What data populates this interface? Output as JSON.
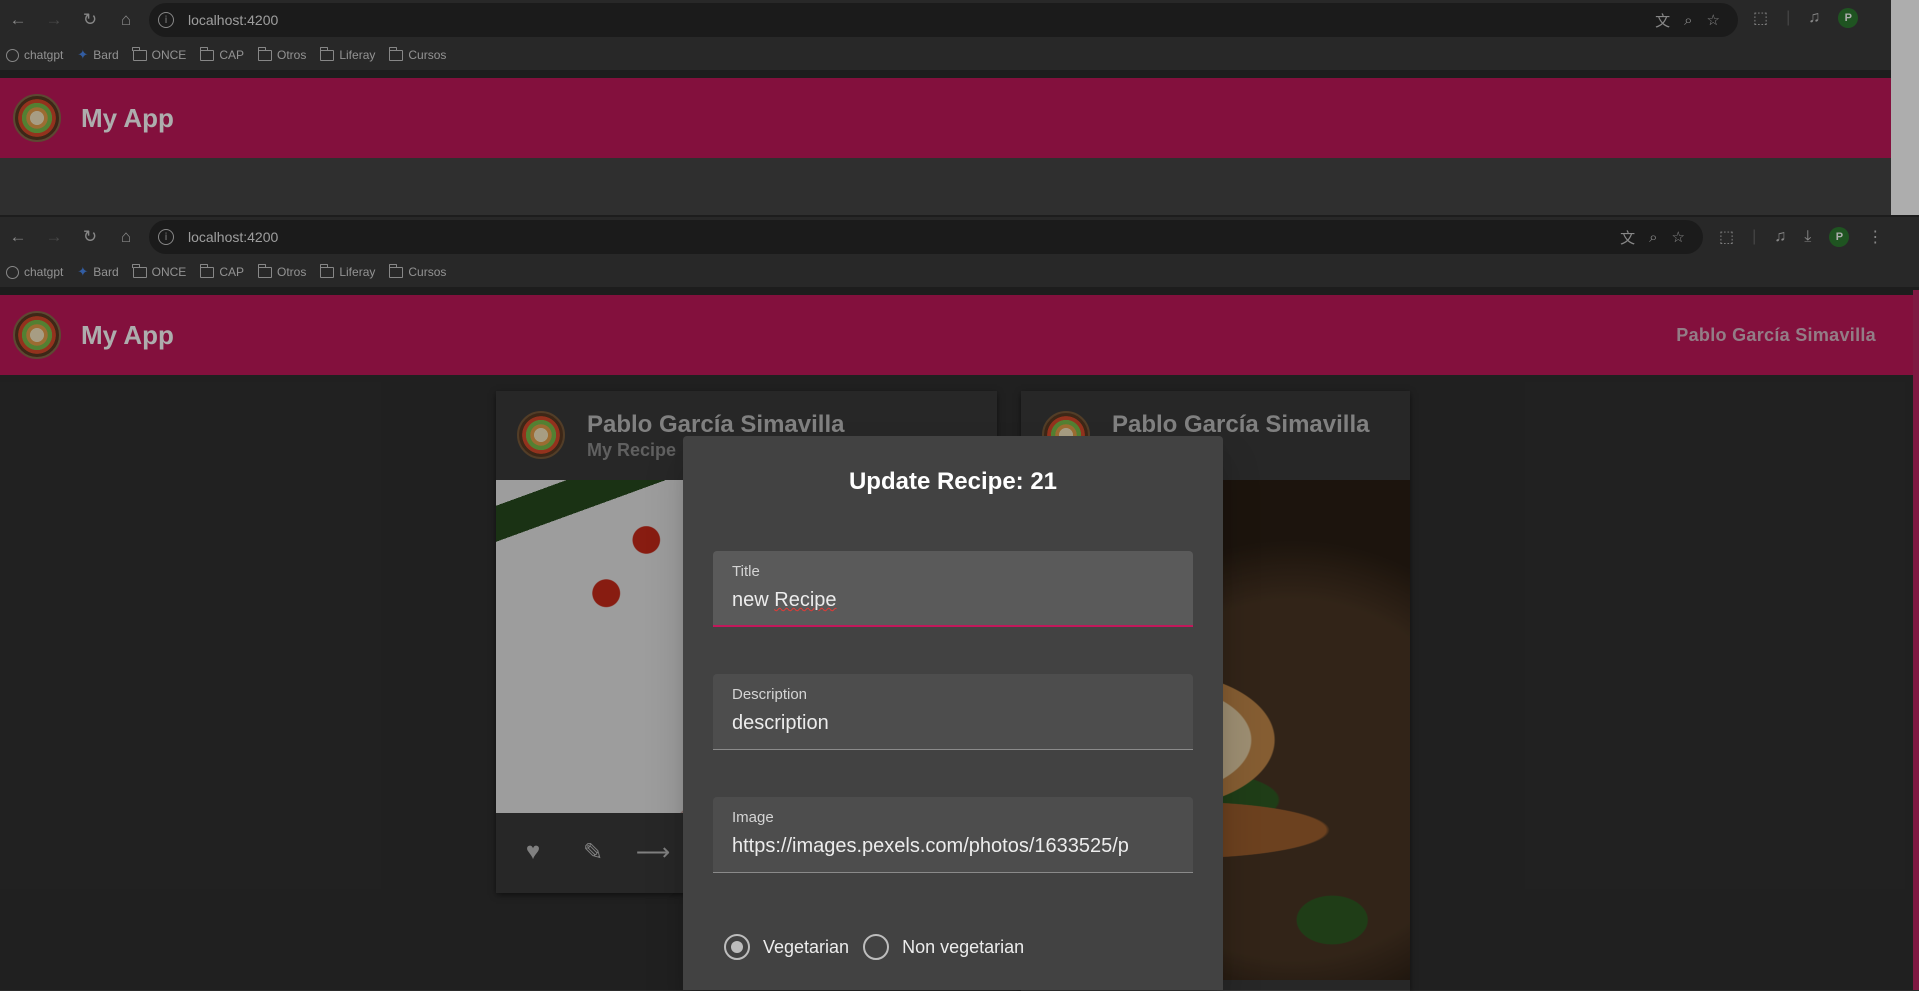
{
  "browser_top": {
    "url": "localhost:4200",
    "bookmarks": [
      "chatgpt",
      "Bard",
      "ONCE",
      "CAP",
      "Otros",
      "Liferay",
      "Cursos"
    ],
    "profile_initial": "P"
  },
  "app_top": {
    "title": "My App"
  },
  "browser_main": {
    "url": "localhost:4200",
    "bookmarks": [
      "chatgpt",
      "Bard",
      "ONCE",
      "CAP",
      "Otros",
      "Liferay",
      "Cursos"
    ],
    "profile_initial": "P"
  },
  "app_main": {
    "title": "My App",
    "user": "Pablo García Simavilla",
    "brand_color": "#c2185b"
  },
  "cards": [
    {
      "author": "Pablo García Simavilla",
      "subtitle": "My Recipe"
    },
    {
      "author": "Pablo García Simavilla"
    }
  ],
  "card_actions": {
    "like": "heart-icon",
    "edit": "pencil-icon",
    "share": "share-icon"
  },
  "dialog": {
    "title": "Update Recipe: 21",
    "fields": {
      "title": {
        "label": "Title",
        "value": "new Recipe"
      },
      "description": {
        "label": "Description",
        "value": "description"
      },
      "image": {
        "label": "Image",
        "value": "https://images.pexels.com/photos/1633525/p"
      }
    },
    "radio": [
      {
        "label": "Vegetarian",
        "checked": true
      },
      {
        "label": "Non vegetarian",
        "checked": false
      }
    ]
  }
}
